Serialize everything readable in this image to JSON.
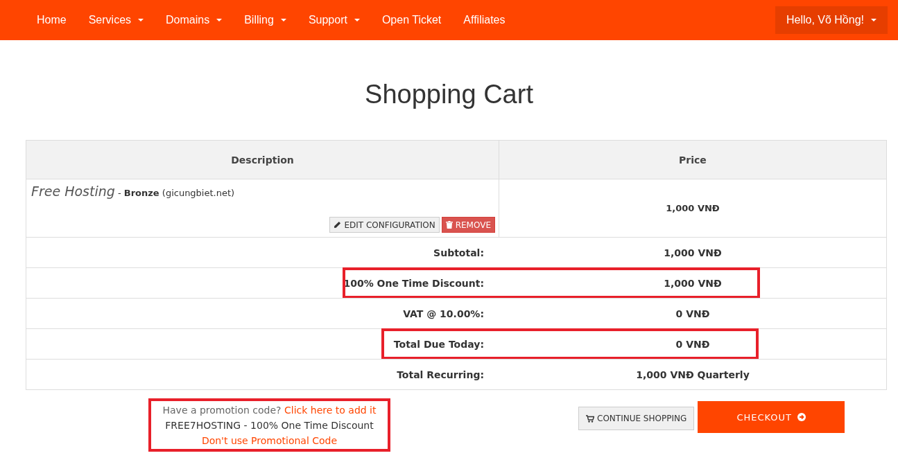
{
  "nav": {
    "items": [
      {
        "label": "Home",
        "dropdown": false
      },
      {
        "label": "Services",
        "dropdown": true
      },
      {
        "label": "Domains",
        "dropdown": true
      },
      {
        "label": "Billing",
        "dropdown": true
      },
      {
        "label": "Support",
        "dropdown": true
      },
      {
        "label": "Open Ticket",
        "dropdown": false
      },
      {
        "label": "Affiliates",
        "dropdown": false
      }
    ],
    "user_menu": "Hello, Võ Hồng!"
  },
  "title": "Shopping Cart",
  "table": {
    "columns": [
      "Description",
      "Price"
    ],
    "item": {
      "product": "Free Hosting",
      "plan": "- **Bronze** (gicungbiet.net)",
      "price": "1,000 VNĐ",
      "edit_button": "EDIT CONFIGURATION",
      "remove_button": "REMOVE"
    },
    "summary": [
      {
        "label": "Subtotal:",
        "value": "1,000 VNĐ",
        "highlighted": false
      },
      {
        "label": "100% One Time Discount:",
        "value": "1,000 VNĐ",
        "highlighted": true
      },
      {
        "label": "VAT @ 10.00%:",
        "value": "0 VNĐ",
        "highlighted": false
      },
      {
        "label": "Total Due Today:",
        "value": "0 VNĐ",
        "highlighted": true
      },
      {
        "label": "Total Recurring:",
        "value": "1,000 VNĐ Quarterly",
        "highlighted": false
      }
    ]
  },
  "promo": {
    "highlighted": true,
    "question": "Have a promotion code?",
    "add_link": "Click here to add it",
    "applied": "FREE7HOSTING - 100% One Time Discount",
    "remove_link": "Don't use Promotional Code"
  },
  "buttons": {
    "continue": "CONTINUE SHOPPING",
    "checkout": "CHECKOUT"
  }
}
